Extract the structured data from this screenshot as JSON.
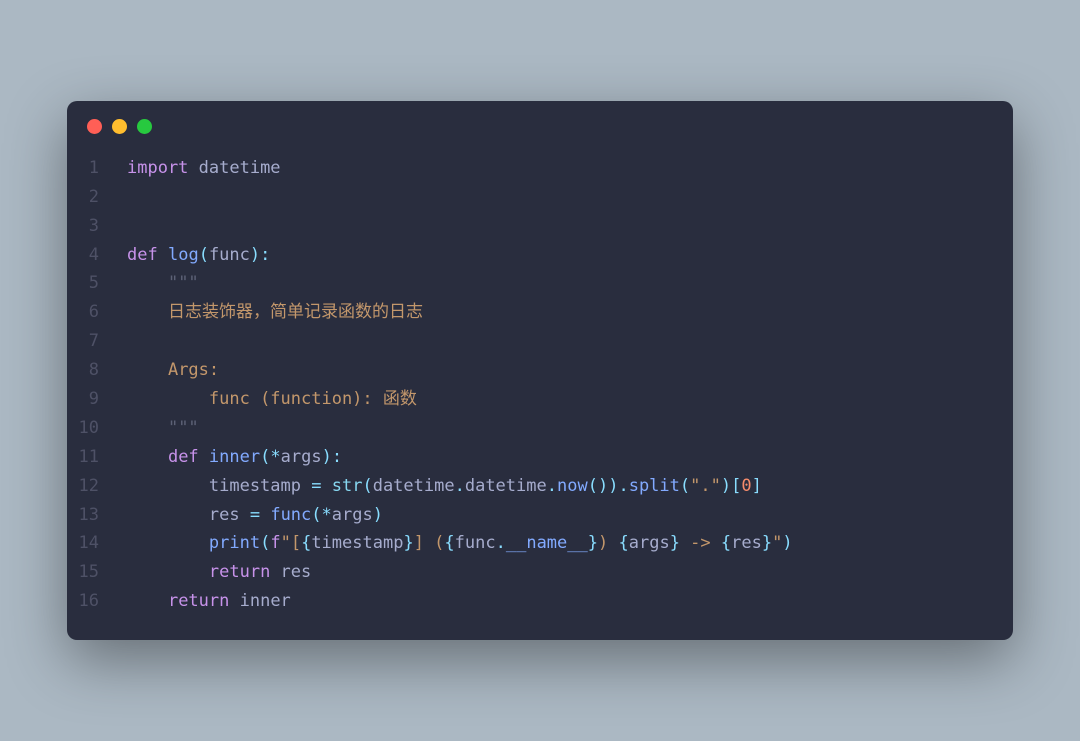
{
  "window": {
    "dots": [
      "red",
      "yellow",
      "green"
    ]
  },
  "lines": [
    {
      "no": "1",
      "tokens": [
        {
          "c": "kw",
          "t": "import"
        },
        {
          "c": "var",
          "t": " datetime"
        }
      ]
    },
    {
      "no": "2",
      "tokens": []
    },
    {
      "no": "3",
      "tokens": []
    },
    {
      "no": "4",
      "tokens": [
        {
          "c": "kw",
          "t": "def"
        },
        {
          "c": "var",
          "t": " "
        },
        {
          "c": "fn",
          "t": "log"
        },
        {
          "c": "punct",
          "t": "("
        },
        {
          "c": "var",
          "t": "func"
        },
        {
          "c": "punct",
          "t": ")"
        },
        {
          "c": "punct",
          "t": ":"
        }
      ]
    },
    {
      "no": "5",
      "tokens": [
        {
          "c": "var",
          "t": "    "
        },
        {
          "c": "strq",
          "t": "\"\"\""
        }
      ]
    },
    {
      "no": "6",
      "tokens": [
        {
          "c": "var",
          "t": "    "
        },
        {
          "c": "str",
          "t": "日志装饰器，简单记录函数的日志"
        }
      ]
    },
    {
      "no": "7",
      "tokens": []
    },
    {
      "no": "8",
      "tokens": [
        {
          "c": "var",
          "t": "    "
        },
        {
          "c": "str",
          "t": "Args:"
        }
      ]
    },
    {
      "no": "9",
      "tokens": [
        {
          "c": "var",
          "t": "        "
        },
        {
          "c": "str",
          "t": "func (function): 函数"
        }
      ]
    },
    {
      "no": "10",
      "tokens": [
        {
          "c": "var",
          "t": "    "
        },
        {
          "c": "strq",
          "t": "\"\"\""
        }
      ]
    },
    {
      "no": "11",
      "tokens": [
        {
          "c": "var",
          "t": "    "
        },
        {
          "c": "kw",
          "t": "def"
        },
        {
          "c": "var",
          "t": " "
        },
        {
          "c": "fn",
          "t": "inner"
        },
        {
          "c": "punct",
          "t": "("
        },
        {
          "c": "punct",
          "t": "*"
        },
        {
          "c": "var",
          "t": "args"
        },
        {
          "c": "punct",
          "t": ")"
        },
        {
          "c": "punct",
          "t": ":"
        }
      ]
    },
    {
      "no": "12",
      "tokens": [
        {
          "c": "var",
          "t": "        timestamp "
        },
        {
          "c": "punct",
          "t": "="
        },
        {
          "c": "var",
          "t": " "
        },
        {
          "c": "builtin",
          "t": "str"
        },
        {
          "c": "punct",
          "t": "("
        },
        {
          "c": "var",
          "t": "datetime"
        },
        {
          "c": "punct",
          "t": "."
        },
        {
          "c": "var",
          "t": "datetime"
        },
        {
          "c": "punct",
          "t": "."
        },
        {
          "c": "fn",
          "t": "now"
        },
        {
          "c": "punct",
          "t": "("
        },
        {
          "c": "punct",
          "t": ")"
        },
        {
          "c": "punct",
          "t": ")"
        },
        {
          "c": "punct",
          "t": "."
        },
        {
          "c": "fn",
          "t": "split"
        },
        {
          "c": "punct",
          "t": "("
        },
        {
          "c": "str",
          "t": "\".\""
        },
        {
          "c": "punct",
          "t": ")"
        },
        {
          "c": "punct",
          "t": "["
        },
        {
          "c": "num",
          "t": "0"
        },
        {
          "c": "punct",
          "t": "]"
        }
      ]
    },
    {
      "no": "13",
      "tokens": [
        {
          "c": "var",
          "t": "        res "
        },
        {
          "c": "punct",
          "t": "="
        },
        {
          "c": "var",
          "t": " "
        },
        {
          "c": "fn",
          "t": "func"
        },
        {
          "c": "punct",
          "t": "("
        },
        {
          "c": "punct",
          "t": "*"
        },
        {
          "c": "var",
          "t": "args"
        },
        {
          "c": "punct",
          "t": ")"
        }
      ]
    },
    {
      "no": "14",
      "tokens": [
        {
          "c": "var",
          "t": "        "
        },
        {
          "c": "fn",
          "t": "print"
        },
        {
          "c": "punct",
          "t": "("
        },
        {
          "c": "kw",
          "t": "f"
        },
        {
          "c": "str",
          "t": "\"["
        },
        {
          "c": "punct",
          "t": "{"
        },
        {
          "c": "var",
          "t": "timestamp"
        },
        {
          "c": "punct",
          "t": "}"
        },
        {
          "c": "str",
          "t": "] ("
        },
        {
          "c": "punct",
          "t": "{"
        },
        {
          "c": "var",
          "t": "func"
        },
        {
          "c": "punct",
          "t": "."
        },
        {
          "c": "dunder",
          "t": "__name__"
        },
        {
          "c": "punct",
          "t": "}"
        },
        {
          "c": "str",
          "t": ") "
        },
        {
          "c": "punct",
          "t": "{"
        },
        {
          "c": "var",
          "t": "args"
        },
        {
          "c": "punct",
          "t": "}"
        },
        {
          "c": "str",
          "t": " -> "
        },
        {
          "c": "punct",
          "t": "{"
        },
        {
          "c": "var",
          "t": "res"
        },
        {
          "c": "punct",
          "t": "}"
        },
        {
          "c": "str",
          "t": "\""
        },
        {
          "c": "punct",
          "t": ")"
        }
      ]
    },
    {
      "no": "15",
      "tokens": [
        {
          "c": "var",
          "t": "        "
        },
        {
          "c": "kw",
          "t": "return"
        },
        {
          "c": "var",
          "t": " res"
        }
      ]
    },
    {
      "no": "16",
      "tokens": [
        {
          "c": "var",
          "t": "    "
        },
        {
          "c": "kw",
          "t": "return"
        },
        {
          "c": "var",
          "t": " inner"
        }
      ]
    }
  ]
}
